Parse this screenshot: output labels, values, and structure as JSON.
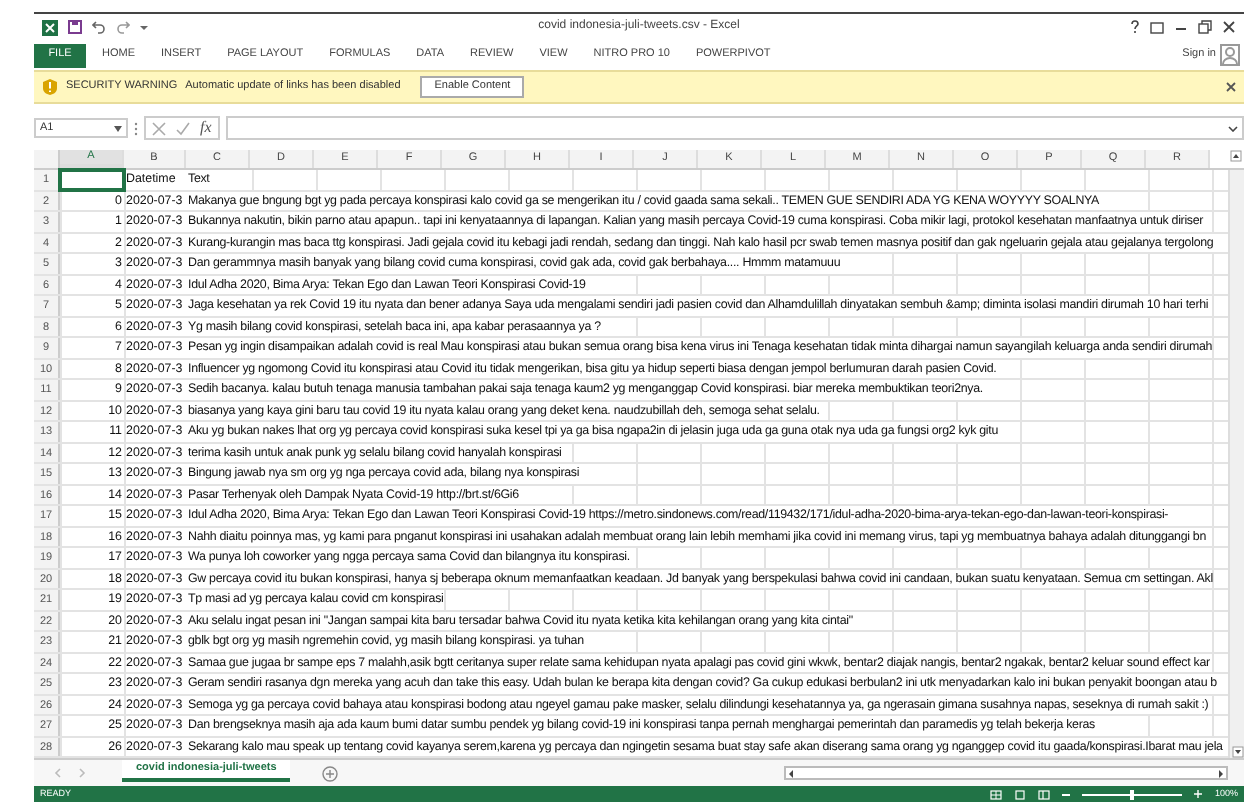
{
  "window": {
    "title": "covid indonesia-juli-tweets.csv - Excel"
  },
  "ribbon": {
    "file_button": "FILE",
    "tabs": [
      {
        "label": "HOME",
        "selected": false
      },
      {
        "label": "INSERT",
        "selected": false
      },
      {
        "label": "PAGE LAYOUT",
        "selected": false
      },
      {
        "label": "FORMULAS",
        "selected": false
      },
      {
        "label": "DATA",
        "selected": false
      },
      {
        "label": "REVIEW",
        "selected": false
      },
      {
        "label": "VIEW",
        "selected": false
      },
      {
        "label": "NITRO PRO 10",
        "selected": false
      },
      {
        "label": "POWERPIVOT",
        "selected": false
      }
    ],
    "sign_in": "Sign in"
  },
  "security_warning": {
    "title": "SECURITY WARNING",
    "message": "Automatic update of links has been disabled",
    "button": "Enable Content"
  },
  "formula_bar": {
    "name_box": "A1",
    "function_label": "fx"
  },
  "columns": [
    {
      "label": "A",
      "selected": true
    },
    {
      "label": "B",
      "selected": false
    },
    {
      "label": "C",
      "selected": false
    },
    {
      "label": "D",
      "selected": false
    },
    {
      "label": "E",
      "selected": false
    },
    {
      "label": "F",
      "selected": false
    },
    {
      "label": "G",
      "selected": false
    },
    {
      "label": "H",
      "selected": false
    },
    {
      "label": "I",
      "selected": false
    },
    {
      "label": "J",
      "selected": false
    },
    {
      "label": "K",
      "selected": false
    },
    {
      "label": "L",
      "selected": false
    },
    {
      "label": "M",
      "selected": false
    },
    {
      "label": "N",
      "selected": false
    },
    {
      "label": "O",
      "selected": false
    },
    {
      "label": "P",
      "selected": false
    },
    {
      "label": "Q",
      "selected": false
    },
    {
      "label": "R",
      "selected": false
    }
  ],
  "rows": [
    {
      "number": "1",
      "index": "",
      "datetime": "Datetime",
      "text": "Text",
      "selected": true
    },
    {
      "number": "2",
      "index": "0",
      "datetime": "2020-07-3",
      "text": "Makanya gue bngung bgt yg pada percaya konspirasi kalo covid ga se mengerikan itu / covid gaada sama sekali.. TEMEN GUE SENDIRI ADA YG KENA WOYYYY SOALNYA",
      "selected": false
    },
    {
      "number": "3",
      "index": "1",
      "datetime": "2020-07-3",
      "text": "Bukannya nakutin, bikin parno atau apapun.. tapi ini kenyataannya di lapangan. Kalian yang masih percaya Covid-19 cuma konspirasi. Coba mikir lagi, protokol kesehatan manfaatnya untuk diriser",
      "selected": false
    },
    {
      "number": "4",
      "index": "2",
      "datetime": "2020-07-3",
      "text": "Kurang-kurangin mas baca ttg konspirasi. Jadi gejala covid itu kebagi jadi rendah, sedang dan tinggi. Nah kalo hasil pcr swab temen masnya positif dan gak ngeluarin gejala atau gejalanya tergolong",
      "selected": false
    },
    {
      "number": "5",
      "index": "3",
      "datetime": "2020-07-3",
      "text": "Dan gerammnya masih banyak yang bilang covid cuma konspirasi, covid gak ada, covid gak berbahaya.... Hmmm matamuuu",
      "selected": false
    },
    {
      "number": "6",
      "index": "4",
      "datetime": "2020-07-3",
      "text": "Idul Adha 2020, Bima Arya: Tekan Ego dan Lawan Teori Konspirasi Covid-19",
      "selected": false
    },
    {
      "number": "7",
      "index": "5",
      "datetime": "2020-07-3",
      "text": "Jaga kesehatan ya rek Covid 19 itu nyata dan bener adanya Saya uda mengalami sendiri jadi pasien covid dan Alhamdulillah dinyatakan sembuh &amp; diminta isolasi mandiri dirumah 10 hari terhi",
      "selected": false
    },
    {
      "number": "8",
      "index": "6",
      "datetime": "2020-07-3",
      "text": "Yg masih bilang covid konspirasi, setelah baca ini, apa kabar perasaannya ya ?",
      "selected": false
    },
    {
      "number": "9",
      "index": "7",
      "datetime": "2020-07-3",
      "text": "Pesan yg ingin disampaikan adalah covid is real Mau konspirasi atau bukan semua orang bisa kena virus ini Tenaga kesehatan tidak minta dihargai namun sayangilah keluarga anda sendiri dirumah",
      "selected": false
    },
    {
      "number": "10",
      "index": "8",
      "datetime": "2020-07-3",
      "text": "Influencer yg ngomong Covid itu konspirasi atau Covid itu tidak mengerikan, bisa gitu ya hidup seperti biasa dengan jempol berlumuran darah pasien Covid.",
      "selected": false
    },
    {
      "number": "11",
      "index": "9",
      "datetime": "2020-07-3",
      "text": "Sedih bacanya. kalau butuh tenaga manusia tambahan pakai saja tenaga kaum2 yg menganggap Covid konspirasi. biar mereka membuktikan teori2nya.",
      "selected": false
    },
    {
      "number": "12",
      "index": "10",
      "datetime": "2020-07-3",
      "text": "biasanya yang kaya gini baru tau covid 19 itu nyata kalau orang yang deket kena. naudzubillah deh, semoga sehat selalu.",
      "selected": false
    },
    {
      "number": "13",
      "index": "11",
      "datetime": "2020-07-3",
      "text": "Aku yg bukan nakes lhat org yg percaya covid konspirasi suka kesel tpi ya ga bisa ngapa2in di jelasin juga uda ga guna otak nya uda ga fungsi org2 kyk gitu",
      "selected": false
    },
    {
      "number": "14",
      "index": "12",
      "datetime": "2020-07-3",
      "text": "terima kasih untuk anak punk yg selalu bilang covid hanyalah konspirasi",
      "selected": false
    },
    {
      "number": "15",
      "index": "13",
      "datetime": "2020-07-3",
      "text": "Bingung jawab nya sm org yg nga percaya covid ada, bilang nya konspirasi",
      "selected": false
    },
    {
      "number": "16",
      "index": "14",
      "datetime": "2020-07-3",
      "text": "Pasar Terhenyak oleh Dampak Nyata Covid-19 http://brt.st/6Gi6",
      "selected": false
    },
    {
      "number": "17",
      "index": "15",
      "datetime": "2020-07-3",
      "text": "Idul Adha 2020, Bima Arya: Tekan Ego dan Lawan Teori Konspirasi Covid-19 https://metro.sindonews.com/read/119432/171/idul-adha-2020-bima-arya-tekan-ego-dan-lawan-teori-konspirasi-",
      "selected": false
    },
    {
      "number": "18",
      "index": "16",
      "datetime": "2020-07-3",
      "text": "Nahh diaitu poinnya mas, yg kami para pnganut konspirasi ini usahakan adalah membuat orang lain lebih memhami jika covid ini memang virus, tapi yg membuatnya bahaya adalah ditunggangi bn",
      "selected": false
    },
    {
      "number": "19",
      "index": "17",
      "datetime": "2020-07-3",
      "text": "Wa punya loh coworker yang ngga percaya sama Covid dan bilangnya itu konspirasi.",
      "selected": false
    },
    {
      "number": "20",
      "index": "18",
      "datetime": "2020-07-3",
      "text": "Gw percaya covid itu bukan konspirasi, hanya sj beberapa oknum memanfaatkan keadaan. Jd banyak yang berspekulasi bahwa covid ini candaan, bukan suatu kenyataan. Semua cm settingan. Akl",
      "selected": false
    },
    {
      "number": "21",
      "index": "19",
      "datetime": "2020-07-3",
      "text": "Tp masi ad yg percaya kalau covid cm konspirasi",
      "selected": false
    },
    {
      "number": "22",
      "index": "20",
      "datetime": "2020-07-3",
      "text": "Aku selalu ingat pesan ini \"Jangan sampai kita baru tersadar bahwa Covid itu nyata ketika kita kehilangan orang yang kita cintai\"",
      "selected": false
    },
    {
      "number": "23",
      "index": "21",
      "datetime": "2020-07-3",
      "text": "gblk bgt org yg masih ngremehin covid, yg masih bilang konspirasi. ya tuhan",
      "selected": false
    },
    {
      "number": "24",
      "index": "22",
      "datetime": "2020-07-3",
      "text": "Samaa gue jugaa br sampe eps 7 malahh,asik bgtt ceritanya super relate sama kehidupan nyata apalagi pas covid gini wkwk, bentar2 diajak nangis, bentar2 ngakak, bentar2 keluar sound effect kar",
      "selected": false
    },
    {
      "number": "25",
      "index": "23",
      "datetime": "2020-07-3",
      "text": "Geram sendiri rasanya dgn mereka yang acuh dan take this easy. Udah bulan ke berapa kita dengan covid? Ga cukup edukasi berbulan2 ini utk menyadarkan kalo ini bukan penyakit boongan atau b",
      "selected": false
    },
    {
      "number": "26",
      "index": "24",
      "datetime": "2020-07-3",
      "text": "Semoga yg ga percaya covid bahaya atau konspirasi bodong atau ngeyel gamau pake masker, selalu dilindungi kesehatannya ya, ga ngerasain gimana susahnya napas, seseknya di rumah sakit :)",
      "selected": false
    },
    {
      "number": "27",
      "index": "25",
      "datetime": "2020-07-3",
      "text": "Dan brengseknya masih aja ada kaum bumi datar sumbu pendek yg bilang covid-19 ini konspirasi tanpa pernah menghargai pemerintah dan paramedis yg telah bekerja keras",
      "selected": false
    },
    {
      "number": "28",
      "index": "26",
      "datetime": "2020-07-3",
      "text": "Sekarang kalo mau speak up tentang covid kayanya serem,karena yg percaya dan ngingetin sesama buat stay safe akan diserang sama orang yg nganggep covid itu gaada/konspirasi.Ibarat mau jela",
      "selected": false
    }
  ],
  "sheet_tabs": [
    {
      "label": "covid indonesia-juli-tweets",
      "selected": true
    }
  ],
  "status_bar": {
    "status": "READY",
    "zoom": "100%",
    "zoom_slider": {
      "level": 0.5
    }
  }
}
